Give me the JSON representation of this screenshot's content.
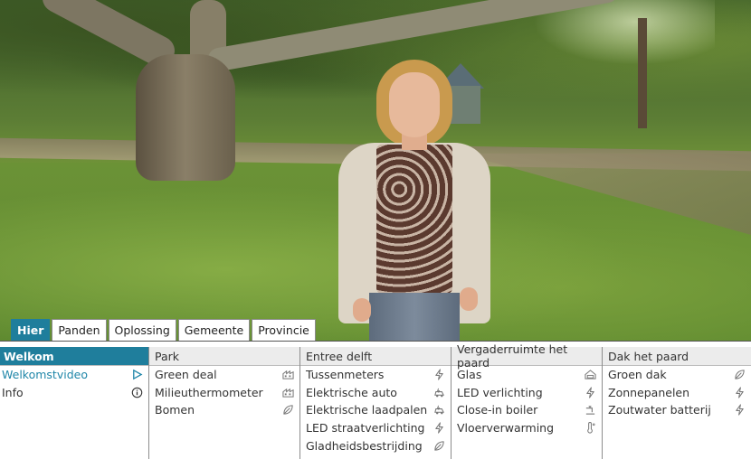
{
  "tabs": [
    {
      "label": "Hier",
      "active": true
    },
    {
      "label": "Panden",
      "active": false
    },
    {
      "label": "Oplossing",
      "active": false
    },
    {
      "label": "Gemeente",
      "active": false
    },
    {
      "label": "Provincie",
      "active": false
    }
  ],
  "columns": [
    {
      "header": "Welkom",
      "active": true,
      "items": [
        {
          "label": "Welkomstvideo",
          "icon": "play-icon",
          "selected": true
        },
        {
          "label": "Info",
          "icon": "info-icon",
          "selected": false
        }
      ]
    },
    {
      "header": "Park",
      "items": [
        {
          "label": "Green deal",
          "icon": "building-icon"
        },
        {
          "label": "Milieuthermometer",
          "icon": "building-icon"
        },
        {
          "label": "Bomen",
          "icon": "leaf-icon"
        }
      ]
    },
    {
      "header": "Entree delft",
      "items": [
        {
          "label": "Tussenmeters",
          "icon": "lightning-icon"
        },
        {
          "label": "Elektrische auto",
          "icon": "car-icon"
        },
        {
          "label": "Elektrische laadpalen",
          "icon": "car-icon"
        },
        {
          "label": "LED straatverlichting",
          "icon": "lightning-icon"
        },
        {
          "label": "Gladheidsbestrijding",
          "icon": "leaf-icon"
        }
      ]
    },
    {
      "header": "Vergaderruimte het paard",
      "items": [
        {
          "label": "Glas",
          "icon": "house-icon"
        },
        {
          "label": "LED verlichting",
          "icon": "lightning-icon"
        },
        {
          "label": "Close-in boiler",
          "icon": "tap-icon"
        },
        {
          "label": "Vloerverwarming",
          "icon": "thermometer-icon"
        }
      ]
    },
    {
      "header": "Dak het paard",
      "items": [
        {
          "label": "Groen dak",
          "icon": "leaf-icon"
        },
        {
          "label": "Zonnepanelen",
          "icon": "lightning-icon"
        },
        {
          "label": "Zoutwater batterij",
          "icon": "lightning-icon"
        }
      ]
    }
  ],
  "colors": {
    "accent": "#1f7e9c",
    "link": "#1f86a8"
  }
}
